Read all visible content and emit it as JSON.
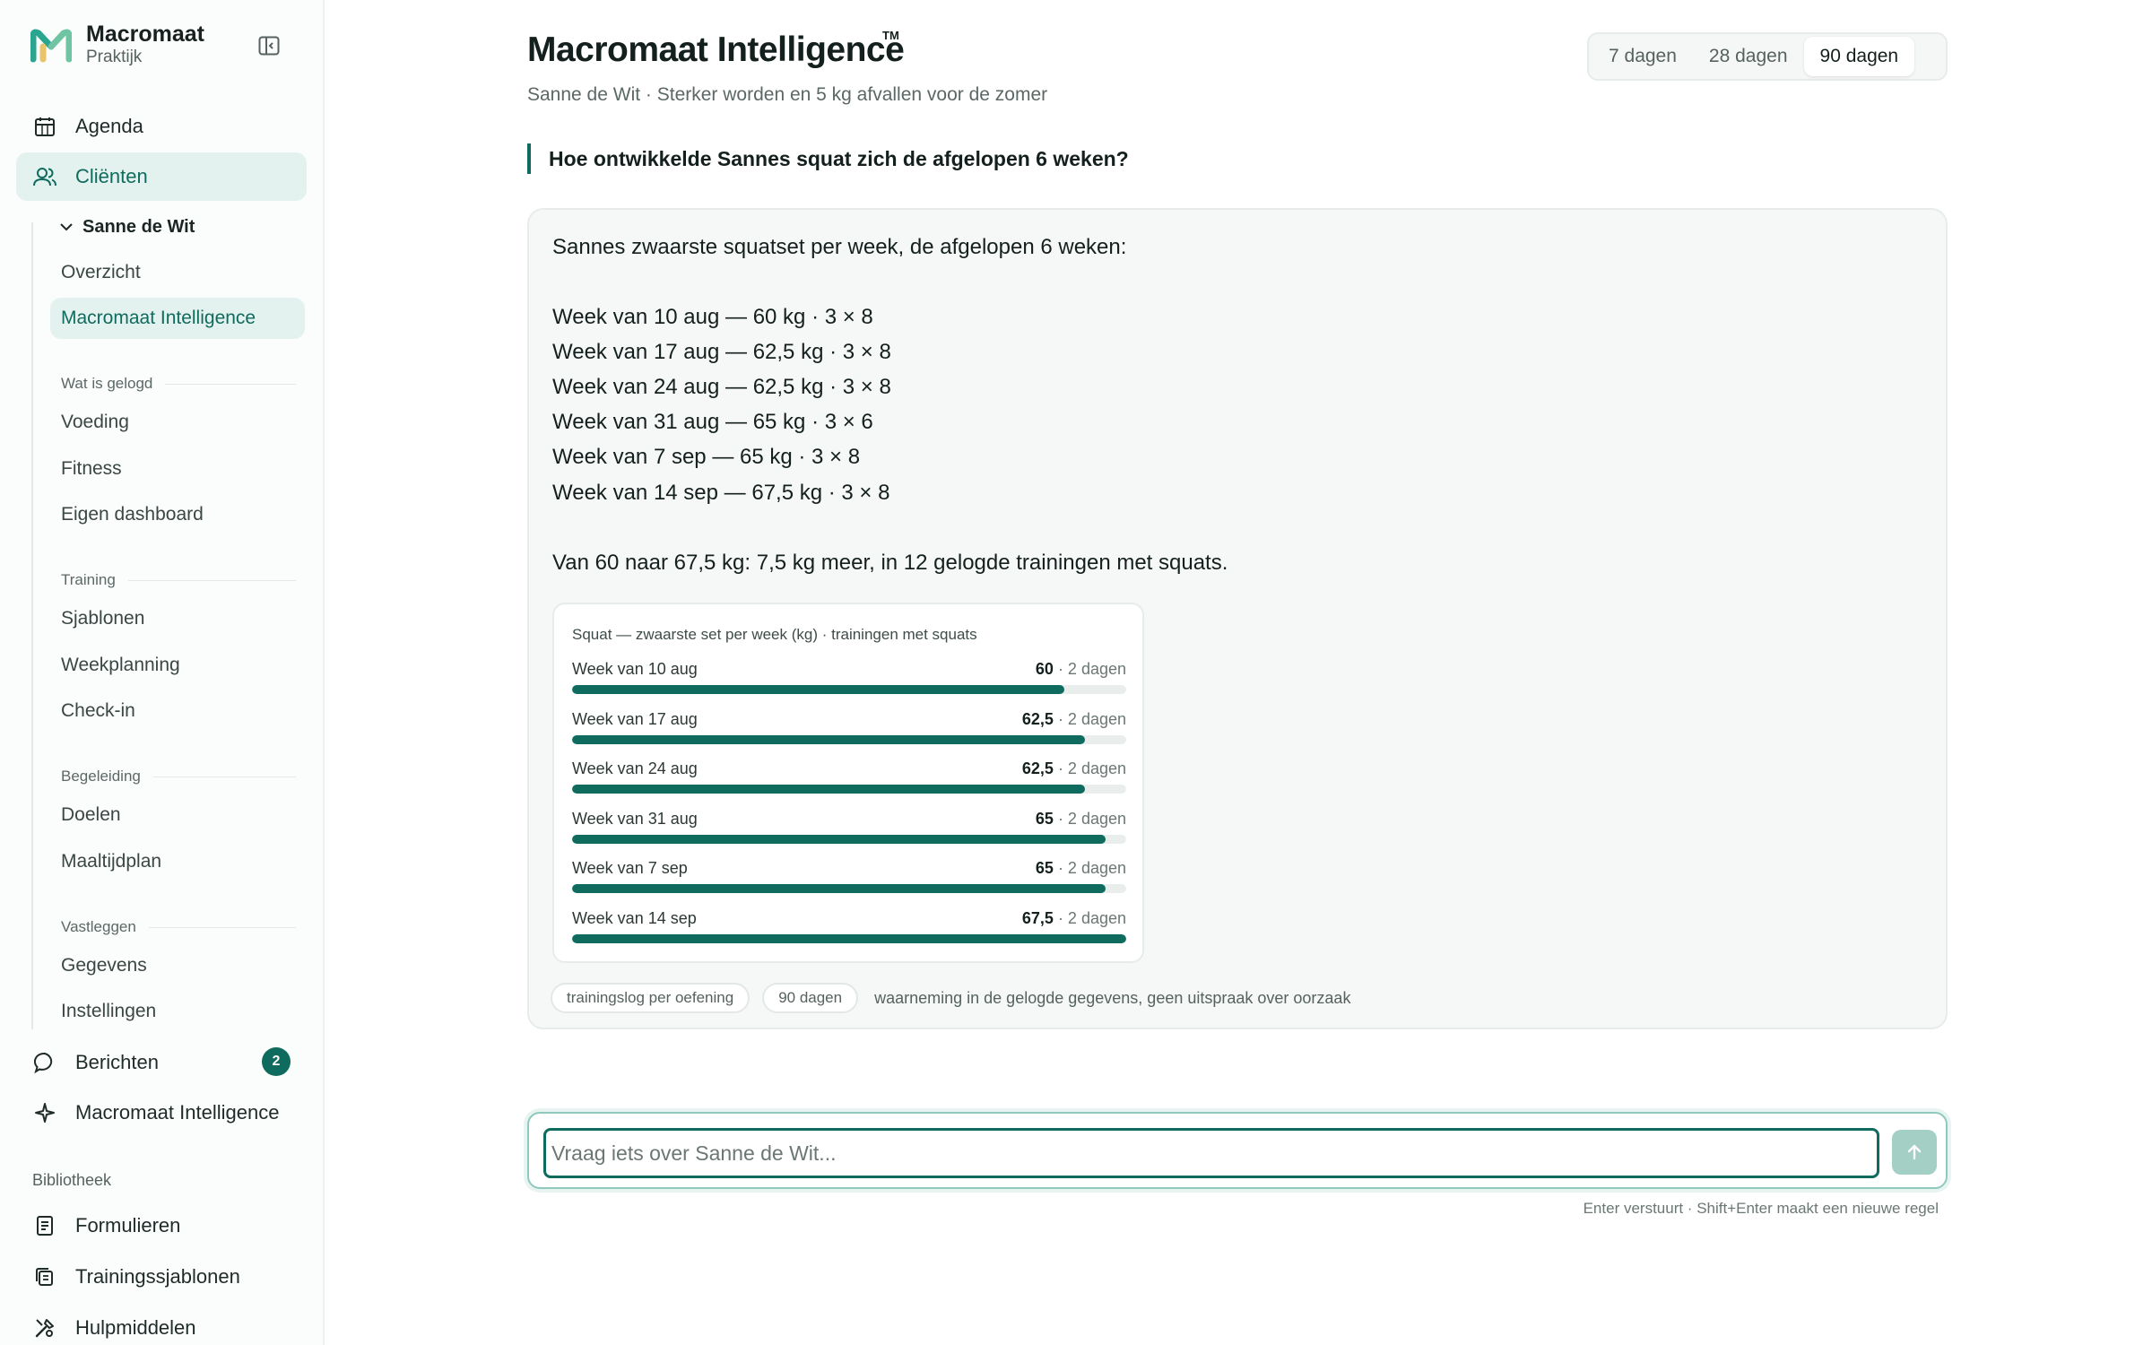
{
  "brand": {
    "name": "Macromaat",
    "sub": "Praktijk"
  },
  "nav": {
    "agenda": "Agenda",
    "clients": "Cliënten",
    "client_name": "Sanne de Wit",
    "overview": "Overzicht",
    "intelligence": "Macromaat Intelligence",
    "sec_logged": "Wat is gelogd",
    "nutrition": "Voeding",
    "fitness": "Fitness",
    "dashboard": "Eigen dashboard",
    "sec_training": "Training",
    "templates": "Sjablonen",
    "weekplan": "Weekplanning",
    "checkin": "Check-in",
    "sec_guidance": "Begeleiding",
    "goals": "Doelen",
    "mealplan": "Maaltijdplan",
    "sec_record": "Vastleggen",
    "data": "Gegevens",
    "settings": "Instellingen",
    "messages": "Berichten",
    "messages_badge": "2",
    "intelligence_top": "Macromaat Intelligence",
    "library": "Bibliotheek",
    "forms": "Formulieren",
    "training_templates": "Trainingssjablonen",
    "tools": "Hulpmiddelen"
  },
  "header": {
    "title": "Macromaat Intelligence",
    "tm": "TM",
    "subtitle": "Sanne de Wit · Sterker worden en 5 kg afvallen voor de zomer",
    "ranges": [
      "7 dagen",
      "28 dagen",
      "90 dagen"
    ],
    "active_range": "90 dagen"
  },
  "question": "Hoe ontwikkelde Sannes squat zich de afgelopen 6 weken?",
  "answer": {
    "intro": "Sannes zwaarste squatset per week, de afgelopen 6 weken:",
    "lines": [
      "Week van 10 aug — 60 kg · 3 × 8",
      "Week van 17 aug — 62,5 kg · 3 × 8",
      "Week van 24 aug — 62,5 kg · 3 × 8",
      "Week van 31 aug — 65 kg · 3 × 6",
      "Week van 7 sep — 65 kg · 3 × 8",
      "Week van 14 sep — 67,5 kg · 3 × 8"
    ],
    "summary": "Van 60 naar 67,5 kg: 7,5 kg meer, in 12 gelogde trainingen met squats.",
    "chips": [
      "trainingslog per oefening",
      "90 dagen"
    ],
    "note": "waarneming in de gelogde gegevens, geen uitspraak over oorzaak"
  },
  "chart_data": {
    "type": "bar",
    "title": "Squat — zwaarste set per week (kg) · trainingen met squats",
    "categories": [
      "Week van 10 aug",
      "Week van 17 aug",
      "Week van 24 aug",
      "Week van 31 aug",
      "Week van 7 sep",
      "Week van 14 sep"
    ],
    "values": [
      60,
      62.5,
      62.5,
      65,
      65,
      67.5
    ],
    "value_labels": [
      "60",
      "62,5",
      "62,5",
      "65",
      "65",
      "67,5"
    ],
    "day_labels": [
      "· 2 dagen",
      "· 2 dagen",
      "· 2 dagen",
      "· 2 dagen",
      "· 2 dagen",
      "· 2 dagen"
    ],
    "xlim": [
      0,
      67.5
    ],
    "orientation": "horizontal",
    "color": "#0f6b5e"
  },
  "composer": {
    "placeholder": "Vraag iets over Sanne de Wit...",
    "hint": "Enter verstuurt · Shift+Enter maakt een nieuwe regel"
  },
  "colors": {
    "accent": "#0f6b5e",
    "accent_light": "#e4f2ef"
  }
}
